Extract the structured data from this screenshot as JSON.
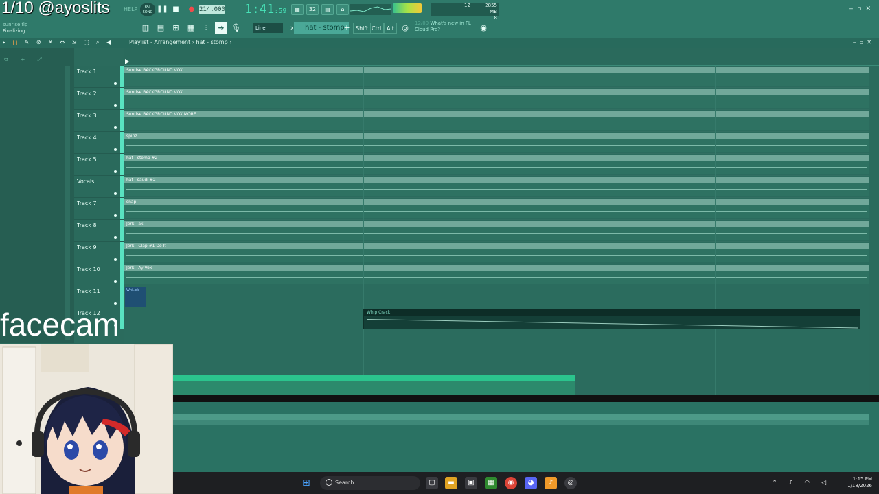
{
  "stream": {
    "title": "1/10 @ayoslits",
    "facecam_label": "facecam"
  },
  "project": {
    "file": "sunrise.flp",
    "status": "Finalizing"
  },
  "toolbar": {
    "help": "HELP",
    "pat_song": "SONG",
    "tempo": "214.000",
    "time_main": "1:41",
    "time_sub": ":59",
    "cpu": "12",
    "memory_mb": "2855 MB",
    "memory_sub": "8",
    "snap_mode": "Line",
    "pattern": "hat - stomp",
    "keys": [
      "Shift",
      "Ctrl",
      "Alt"
    ],
    "news_date": "12/09",
    "news_text": "What's new in FL",
    "news_text2": "Cloud Pro?"
  },
  "playlist": {
    "breadcrumb": "Playlist - Arrangement  ›  hat - stomp  ›",
    "tracks": [
      {
        "name": "Track 1",
        "clip": "Sunrise BACKGROUND VOX"
      },
      {
        "name": "Track 2",
        "clip": "Sunrise BACKGROUND VOX"
      },
      {
        "name": "Track 3",
        "clip": "Sunrise BACKGROUND VOX MORE"
      },
      {
        "name": "Track 4",
        "clip": "spinz"
      },
      {
        "name": "Track 5",
        "clip": "hat - stomp #2"
      },
      {
        "name": "Vocals",
        "clip": "hat - saudi #2"
      },
      {
        "name": "Track 7",
        "clip": "snap"
      },
      {
        "name": "Track 8",
        "clip": "Jerk - ak"
      },
      {
        "name": "Track 9",
        "clip": "Jerk - Clap #1 Do It"
      },
      {
        "name": "Track 10",
        "clip": "Jerk - Ay Vox"
      },
      {
        "name": "Track 11",
        "clip": "Whi..ck"
      },
      {
        "name": "Track 12",
        "clip": ""
      }
    ],
    "whip_clip": "Whip Crack"
  },
  "taskbar": {
    "search": "Search",
    "time": "1:15 PM",
    "date": "1/18/2026"
  },
  "colors": {
    "accent": "#59e3c1",
    "clip_header": "#71a89a",
    "background": "#2b6b5d"
  },
  "icons": [
    "play-icon",
    "stop-icon",
    "record-icon",
    "search-icon",
    "windows-start-icon"
  ]
}
